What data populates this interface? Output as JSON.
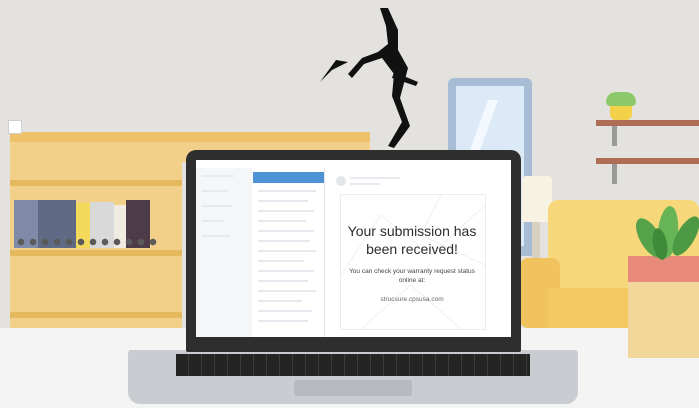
{
  "submission_panel": {
    "title": "Your submission has been received!",
    "body": "You can check your warranty request status online at:",
    "url": "strucsure.cpsusa.com"
  },
  "colors": {
    "wall": "#e4e2de",
    "desk": "#f3f3f3",
    "shelf": "#f1cf85",
    "accent_blue": "#4d93d6",
    "laptop_frame": "#2e2e2e"
  },
  "icons": [
    "wall-crack-icon",
    "window-controls-icon",
    "plant-pot-icon"
  ]
}
